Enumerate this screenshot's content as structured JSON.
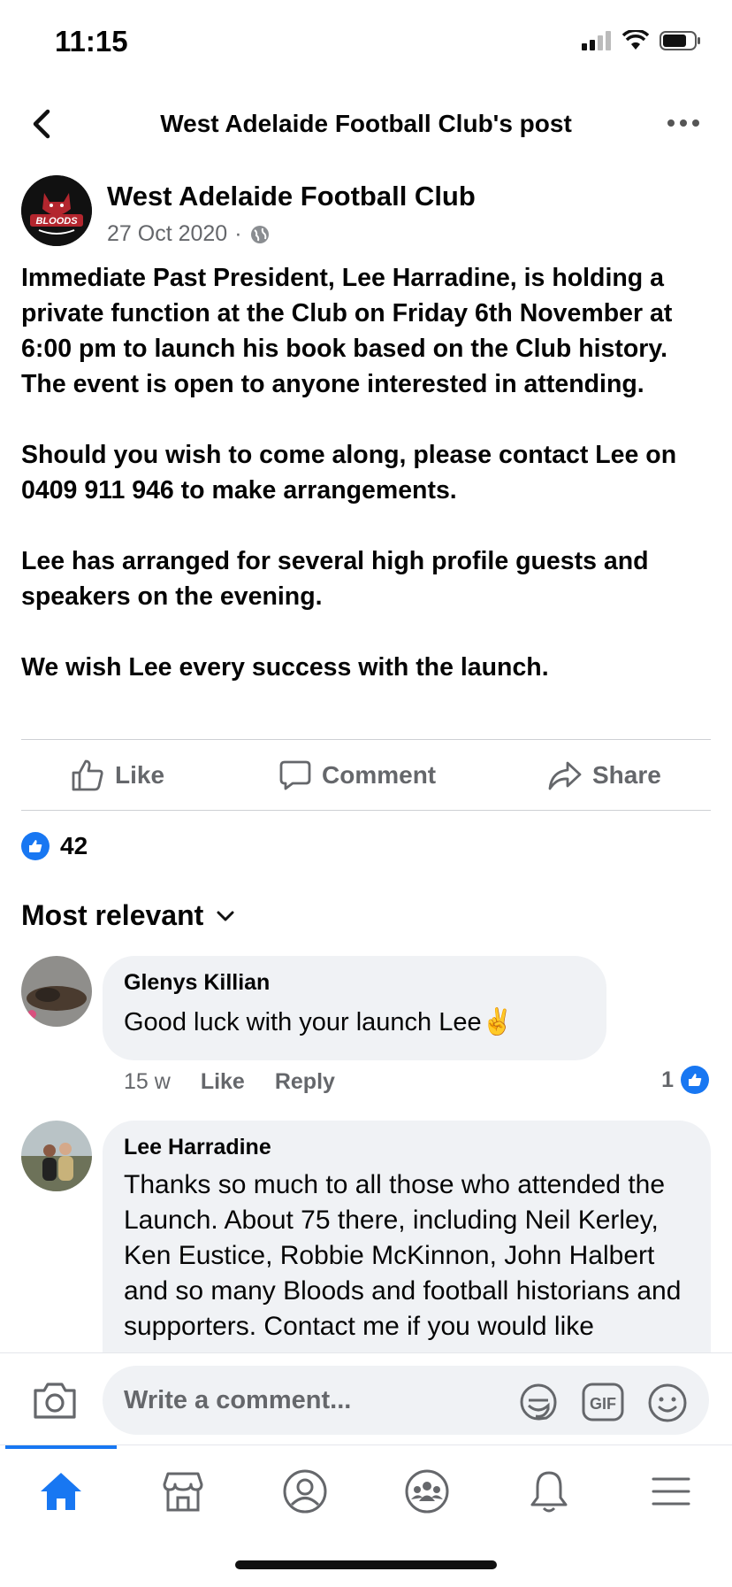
{
  "status_bar": {
    "time": "11:15"
  },
  "header": {
    "title": "West Adelaide Football Club's post"
  },
  "post": {
    "author": "West Adelaide Football Club",
    "avatar_text": "BLOODS",
    "date": "27 Oct 2020",
    "separator": "·",
    "paragraphs": [
      "Immediate Past President, Lee Harradine, is holding a private function at the Club on Friday 6th November at 6:00 pm to launch his book based on the Club history. The event is open to anyone interested in attending.",
      "Should you wish to come along, please contact Lee on 0409 911 946 to make arrangements.",
      "Lee has arranged for several high profile guests and speakers on the evening.",
      "We wish Lee every success with the launch."
    ]
  },
  "actions": {
    "like": "Like",
    "comment": "Comment",
    "share": "Share"
  },
  "reactions": {
    "count": "42"
  },
  "comments_sort": {
    "label": "Most relevant"
  },
  "comments": [
    {
      "name": "Glenys Killian",
      "text": "Good luck with your launch Lee✌️",
      "time": "15 w",
      "like": "Like",
      "reply": "Reply",
      "reaction_count": "1"
    },
    {
      "name": "Lee Harradine",
      "text": "Thanks so much to all those who attended the Launch.  About 75 there, including Neil Kerley, Ken Eustice, Robbie McKinnon, John Halbert and so many Bloods and football historians and supporters.  Contact me if you would like"
    }
  ],
  "composer": {
    "placeholder": "Write a comment..."
  },
  "tabs": [
    "home-icon",
    "marketplace-icon",
    "profile-icon",
    "groups-icon",
    "notifications-icon",
    "menu-icon"
  ],
  "colors": {
    "accent": "#1877f2",
    "secondary_text": "#65676b",
    "bubble": "#f0f2f5"
  }
}
